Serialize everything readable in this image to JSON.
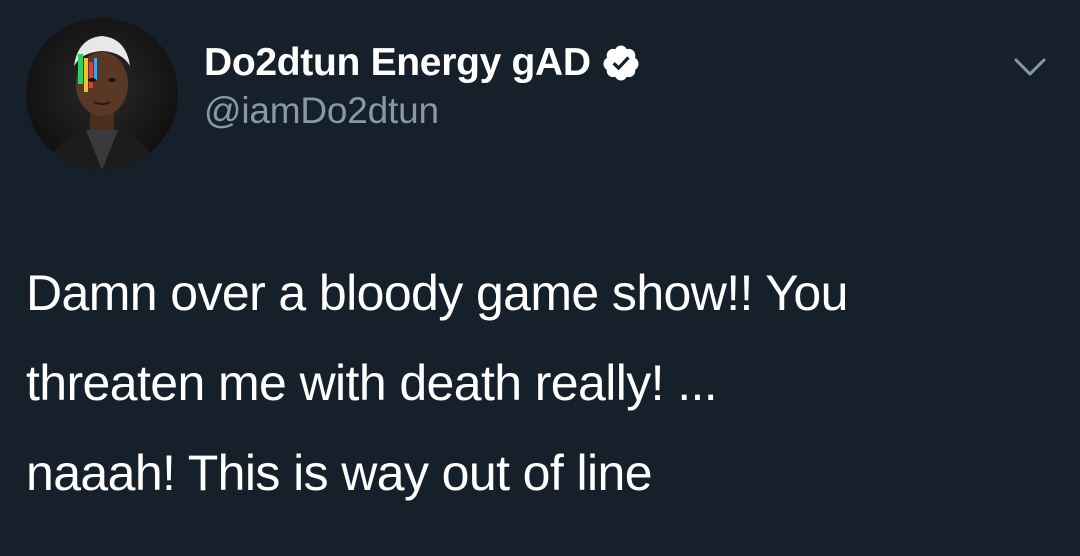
{
  "tweet": {
    "author": {
      "display_name": "Do2dtun Energy gAD",
      "handle": "@iamDo2dtun",
      "verified": true,
      "avatar_icon": "profile-photo"
    },
    "text_lines": [
      "Damn over a bloody game show!!  You",
      "threaten me with death really! ...",
      "naaah! This is way out of line"
    ],
    "menu_icon": "chevron-down-icon"
  },
  "colors": {
    "background": "#15202b",
    "text": "#ffffff",
    "secondary_text": "#8899a6",
    "verified_badge": "#ffffff"
  }
}
